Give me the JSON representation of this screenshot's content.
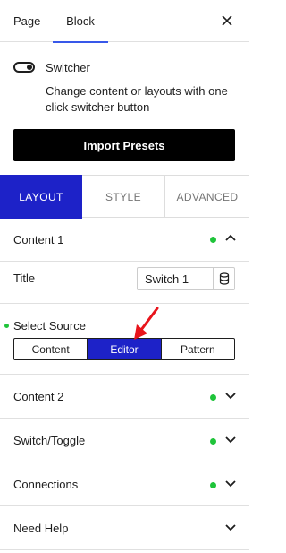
{
  "topbar": {
    "tabs": [
      {
        "label": "Page"
      },
      {
        "label": "Block"
      }
    ],
    "active_tab": "Block",
    "close_icon": "close-icon"
  },
  "block": {
    "icon": "toggle-switch-icon",
    "title": "Switcher",
    "description": "Change content or layouts with one click switcher button",
    "import_button": "Import Presets"
  },
  "panel_tabs": [
    {
      "label": "LAYOUT",
      "active": true
    },
    {
      "label": "STYLE",
      "active": false
    },
    {
      "label": "ADVANCED",
      "active": false
    }
  ],
  "sections": {
    "content1": {
      "label": "Content 1",
      "expanded": true,
      "has_dot": true
    },
    "content2": {
      "label": "Content 2",
      "expanded": false,
      "has_dot": true
    },
    "switch_toggle": {
      "label": "Switch/Toggle",
      "expanded": false,
      "has_dot": true
    },
    "connections": {
      "label": "Connections",
      "expanded": false,
      "has_dot": true
    },
    "need_help": {
      "label": "Need Help",
      "expanded": false,
      "has_dot": false
    }
  },
  "content1_fields": {
    "title_label": "Title",
    "title_value": "Switch 1",
    "dynamic_icon": "database-icon",
    "source_label": "Select Source",
    "source_options": [
      "Content",
      "Editor",
      "Pattern"
    ],
    "source_selected": "Editor"
  },
  "colors": {
    "accent": "#1d22c8",
    "status_dot": "#1fc43a",
    "annotation_arrow": "#e8141c"
  }
}
